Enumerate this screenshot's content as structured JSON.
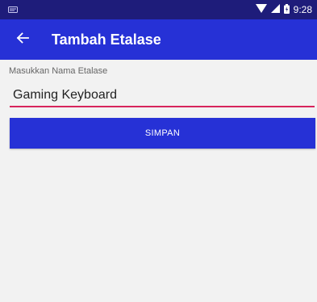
{
  "status_bar": {
    "time": "9:28",
    "icons": [
      "notification-icon",
      "wifi-icon",
      "signal-icon",
      "battery-icon"
    ]
  },
  "app_bar": {
    "title": "Tambah Etalase",
    "back_icon": "arrow-left-icon"
  },
  "form": {
    "label": "Masukkan Nama Etalase",
    "value": "Gaming Keyboard",
    "save_label": "SIMPAN"
  },
  "colors": {
    "status_bar": "#1e1c7a",
    "primary": "#2631d6",
    "accent": "#d7245c",
    "background": "#f2f2f2"
  }
}
